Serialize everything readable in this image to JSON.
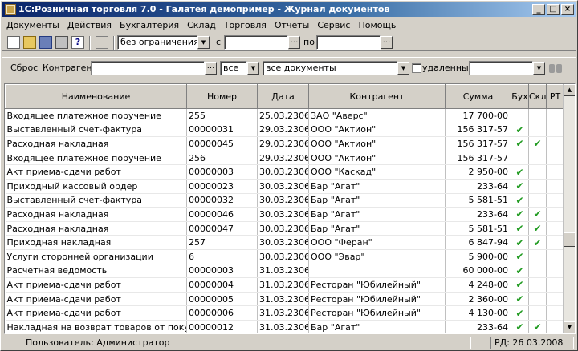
{
  "window": {
    "title": "1С:Розничная торговля 7.0 - Галатея демопример - Журнал документов"
  },
  "menu": [
    "Документы",
    "Действия",
    "Бухгалтерия",
    "Склад",
    "Торговля",
    "Отчеты",
    "Сервис",
    "Помощь"
  ],
  "toolbar": {
    "period_value": "без ограничения",
    "from_label": "с",
    "to_label": "по",
    "from_value": "",
    "to_value": ""
  },
  "filter": {
    "reset_label": "Сброс",
    "contractor_label": "Контрагент",
    "contractor_value": "",
    "scope_value": "все",
    "doctype_value": "все документы",
    "deleted_label": "удаленные",
    "extra_value": ""
  },
  "table": {
    "columns": [
      "Наименование",
      "Номер",
      "Дата",
      "Контрагент",
      "Сумма",
      "Бух",
      "Скл",
      "РТ"
    ],
    "check_glyph": "✔",
    "rows": [
      [
        "Входящее платежное поручение",
        "255",
        "25.03.2306",
        "ЗАО \"Аверс\"",
        "17 700-00",
        "",
        "",
        ""
      ],
      [
        "Выставленный счет-фактура",
        "00000031",
        "29.03.2306",
        "ООО \"Актион\"",
        "156 317-57",
        "✔",
        "",
        ""
      ],
      [
        "Расходная накладная",
        "00000045",
        "29.03.2306",
        "ООО \"Актион\"",
        "156 317-57",
        "✔",
        "✔",
        ""
      ],
      [
        "Входящее платежное поручение",
        "256",
        "29.03.2306",
        "ООО \"Актион\"",
        "156 317-57",
        "",
        "",
        ""
      ],
      [
        "Акт приема-сдачи работ",
        "00000003",
        "30.03.2306",
        "ООО \"Каскад\"",
        "2 950-00",
        "✔",
        "",
        ""
      ],
      [
        "Приходный кассовый ордер",
        "00000023",
        "30.03.2306",
        "Бар \"Агат\"",
        "233-64",
        "✔",
        "",
        ""
      ],
      [
        "Выставленный счет-фактура",
        "00000032",
        "30.03.2306",
        "Бар \"Агат\"",
        "5 581-51",
        "✔",
        "",
        ""
      ],
      [
        "Расходная накладная",
        "00000046",
        "30.03.2306",
        "Бар \"Агат\"",
        "233-64",
        "✔",
        "✔",
        ""
      ],
      [
        "Расходная накладная",
        "00000047",
        "30.03.2306",
        "Бар \"Агат\"",
        "5 581-51",
        "✔",
        "✔",
        ""
      ],
      [
        "Приходная накладная",
        "257",
        "30.03.2306",
        "ООО \"Феран\"",
        "6 847-94",
        "✔",
        "✔",
        ""
      ],
      [
        "Услуги сторонней организации",
        "6",
        "30.03.2306",
        "ООО \"Эвар\"",
        "5 900-00",
        "✔",
        "",
        ""
      ],
      [
        "Расчетная ведомость",
        "00000003",
        "31.03.2306",
        "",
        "60 000-00",
        "✔",
        "",
        ""
      ],
      [
        "Акт приема-сдачи работ",
        "00000004",
        "31.03.2306",
        "Ресторан \"Юбилейный\"",
        "4 248-00",
        "✔",
        "",
        ""
      ],
      [
        "Акт приема-сдачи работ",
        "00000005",
        "31.03.2306",
        "Ресторан \"Юбилейный\"",
        "2 360-00",
        "✔",
        "",
        ""
      ],
      [
        "Акт приема-сдачи работ",
        "00000006",
        "31.03.2306",
        "Ресторан \"Юбилейный\"",
        "4 130-00",
        "✔",
        "",
        ""
      ],
      [
        "Накладная на возврат товаров от покупателя",
        "00000012",
        "31.03.2306",
        "Бар \"Агат\"",
        "233-64",
        "✔",
        "✔",
        ""
      ]
    ]
  },
  "status": {
    "user": "Пользователь: Администратор",
    "rd": "РД: 26 03.2008"
  },
  "colors": {
    "title_start": "#0a246a",
    "title_end": "#a6caf0",
    "check": "#1f9a1f"
  }
}
